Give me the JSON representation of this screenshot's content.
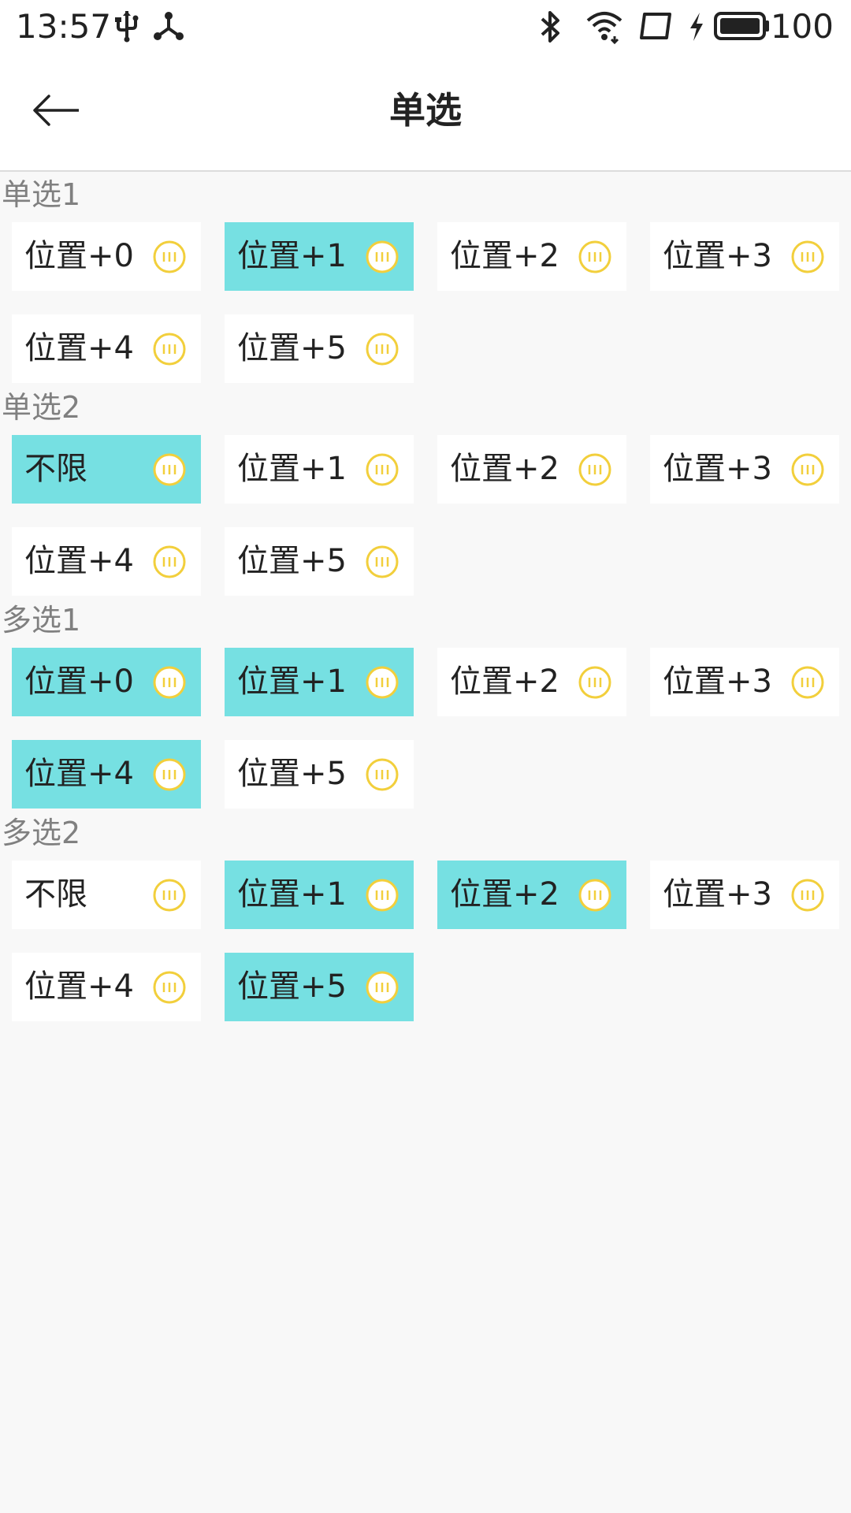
{
  "status_bar": {
    "time": "13:57",
    "battery": "100",
    "icons": [
      "usb-icon",
      "network-share-icon",
      "bluetooth-icon",
      "wifi-icon",
      "screen-icon",
      "charging-icon",
      "battery-icon"
    ]
  },
  "app_bar": {
    "title": "单选",
    "back_icon": "arrow-left-icon"
  },
  "colors": {
    "selected": "#76e0e2",
    "unselected": "#ffffff",
    "icon_yellow": "#f2cf3c",
    "section_title": "#808080"
  },
  "sections": [
    {
      "title": "单选1",
      "options": [
        {
          "label": "位置+0",
          "selected": false
        },
        {
          "label": "位置+1",
          "selected": true
        },
        {
          "label": "位置+2",
          "selected": false
        },
        {
          "label": "位置+3",
          "selected": false
        },
        {
          "label": "位置+4",
          "selected": false
        },
        {
          "label": "位置+5",
          "selected": false
        }
      ]
    },
    {
      "title": "单选2",
      "options": [
        {
          "label": "不限",
          "selected": true
        },
        {
          "label": "位置+1",
          "selected": false
        },
        {
          "label": "位置+2",
          "selected": false
        },
        {
          "label": "位置+3",
          "selected": false
        },
        {
          "label": "位置+4",
          "selected": false
        },
        {
          "label": "位置+5",
          "selected": false
        }
      ]
    },
    {
      "title": "多选1",
      "options": [
        {
          "label": "位置+0",
          "selected": true
        },
        {
          "label": "位置+1",
          "selected": true
        },
        {
          "label": "位置+2",
          "selected": false
        },
        {
          "label": "位置+3",
          "selected": false
        },
        {
          "label": "位置+4",
          "selected": true
        },
        {
          "label": "位置+5",
          "selected": false
        }
      ]
    },
    {
      "title": "多选2",
      "options": [
        {
          "label": "不限",
          "selected": false
        },
        {
          "label": "位置+1",
          "selected": true
        },
        {
          "label": "位置+2",
          "selected": true
        },
        {
          "label": "位置+3",
          "selected": false
        },
        {
          "label": "位置+4",
          "selected": false
        },
        {
          "label": "位置+5",
          "selected": true
        }
      ]
    }
  ]
}
